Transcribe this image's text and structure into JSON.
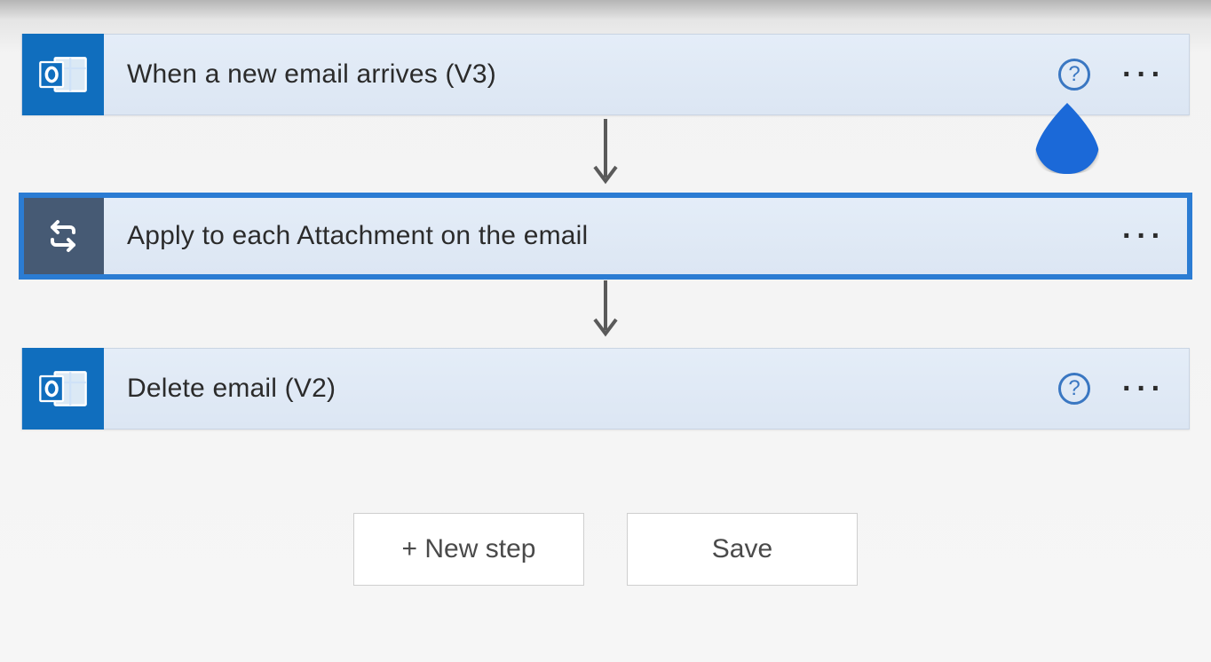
{
  "steps": [
    {
      "title": "When a new email arrives (V3)",
      "iconType": "outlook",
      "showHelp": true,
      "selected": false
    },
    {
      "title": "Apply to each Attachment on the email",
      "iconType": "loop",
      "showHelp": false,
      "selected": true
    },
    {
      "title": "Delete email (V2)",
      "iconType": "outlook",
      "showHelp": true,
      "selected": false
    }
  ],
  "helpGlyph": "?",
  "moreGlyph": "···",
  "footer": {
    "newStep": "+ New step",
    "save": "Save"
  }
}
